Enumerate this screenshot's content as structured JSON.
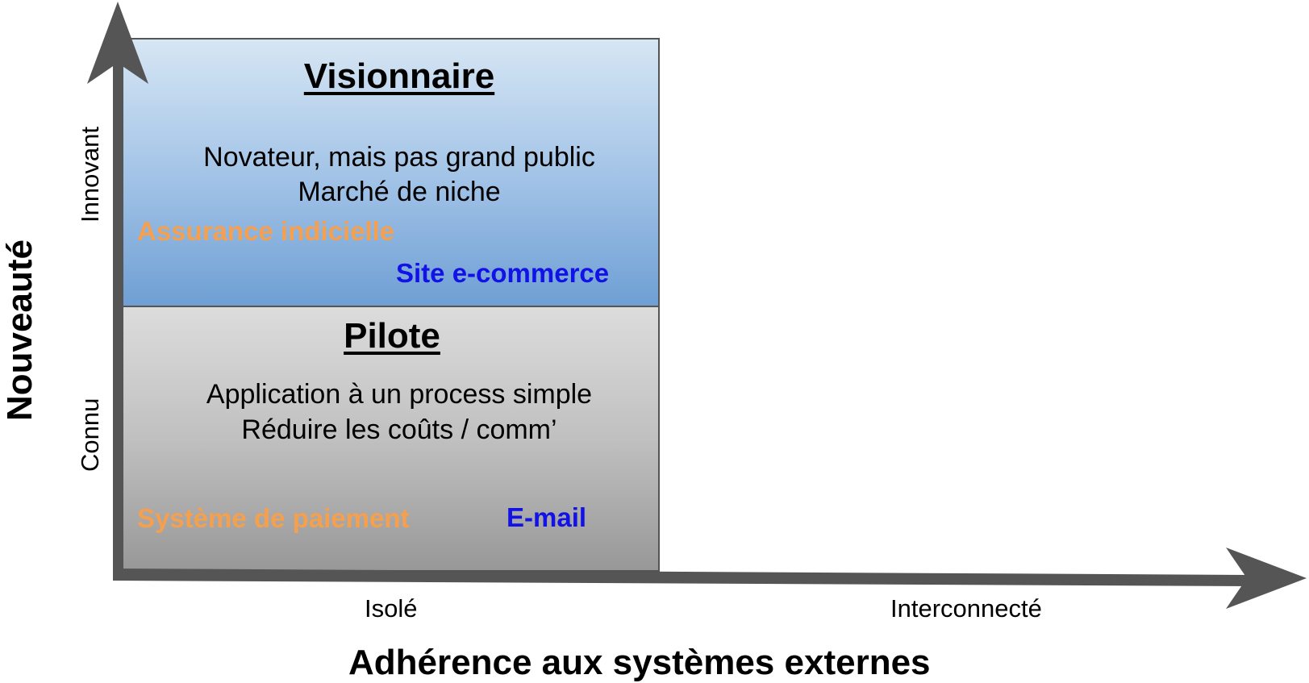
{
  "quadrants": {
    "visionnaire": {
      "title": "Visionnaire",
      "line1": "Novateur, mais pas grand public",
      "line2": "Marché de niche",
      "tag_orange": "Assurance indicielle",
      "tag_blue": "Site e-commerce"
    },
    "pilote": {
      "title": "Pilote",
      "line1": "Application à un process simple",
      "line2": "Réduire les coûts / comm’",
      "tag_orange": "Système de paiement",
      "tag_blue": "E-mail"
    }
  },
  "y_axis": {
    "title": "Nouveauté",
    "tick_high": "Innovant",
    "tick_low": "Connu"
  },
  "x_axis": {
    "title": "Adhérence aux systèmes externes",
    "tick_left": "Isolé",
    "tick_right": "Interconnecté"
  },
  "colors": {
    "axis": "#555555",
    "tag_orange": "#f5a04f",
    "tag_blue": "#1212e6",
    "visionnaire_top": "#d6e6f4",
    "visionnaire_bottom": "#6f9fd4",
    "pilote_top": "#dcdcdc",
    "pilote_bottom": "#989898"
  }
}
